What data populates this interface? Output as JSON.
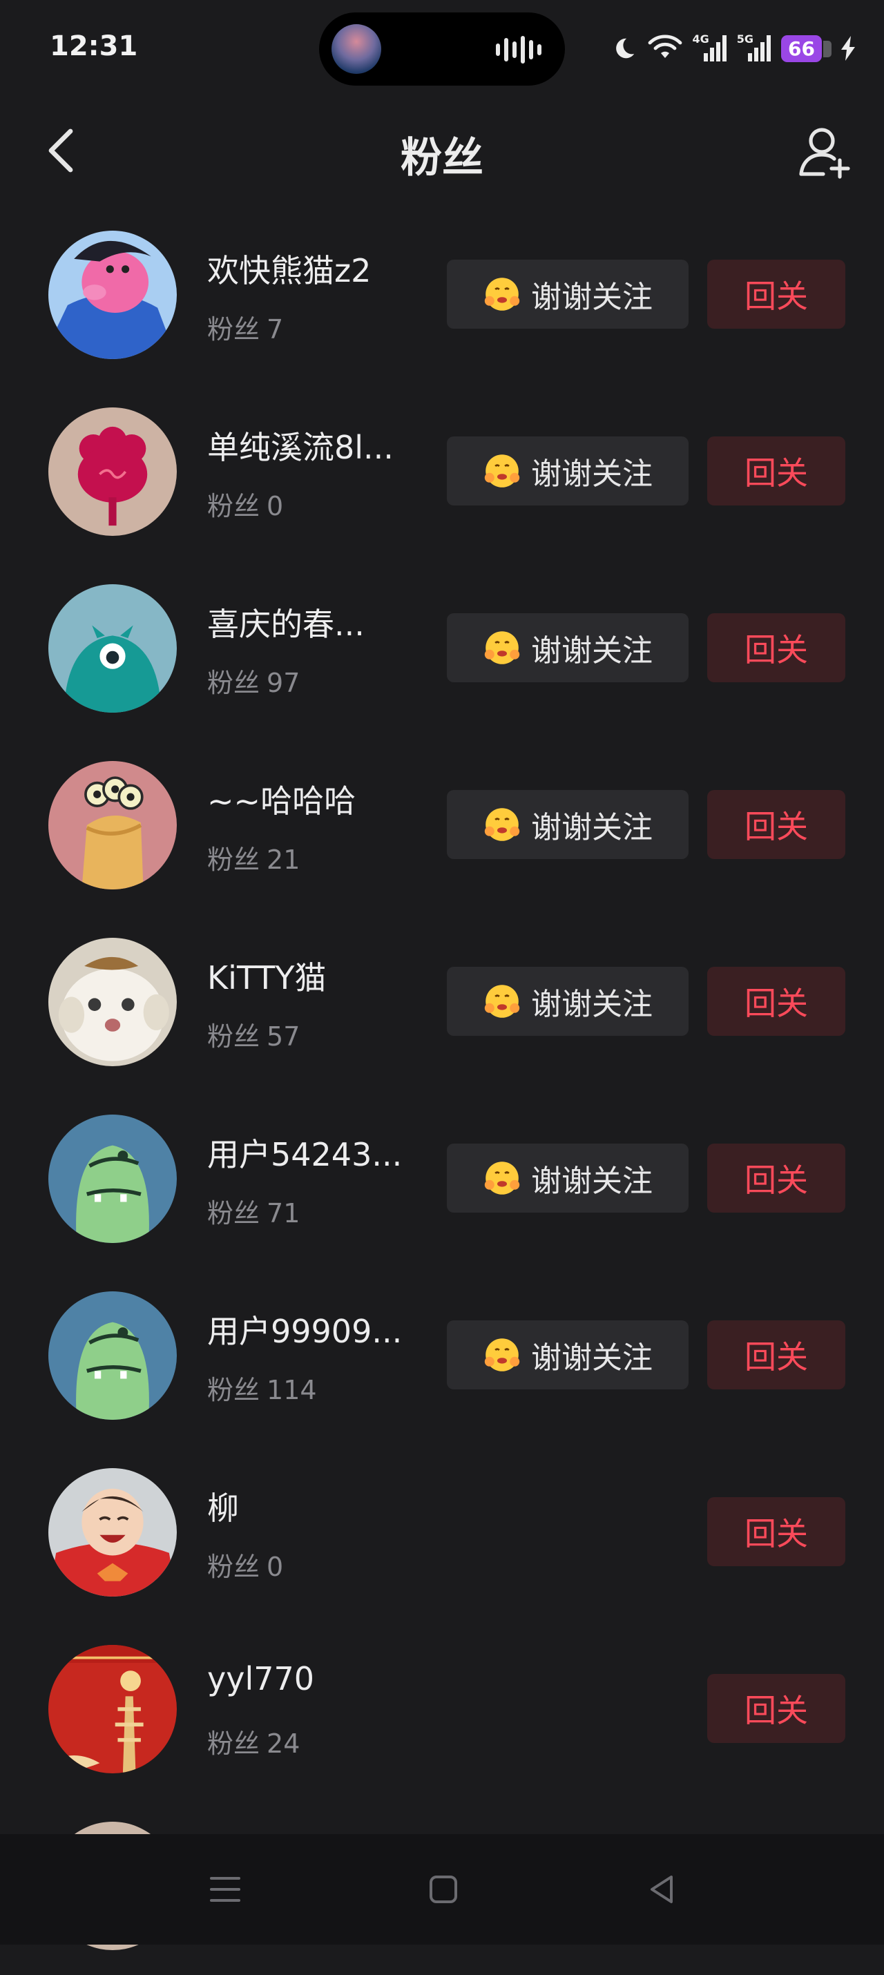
{
  "status_bar": {
    "time": "12:31",
    "net1": "4G",
    "net2": "5G",
    "battery": "66"
  },
  "header": {
    "title": "粉丝"
  },
  "labels": {
    "fans_prefix": "粉丝",
    "thanks": "谢谢关注",
    "follow_back": "回关"
  },
  "fans": [
    {
      "name": "欢快熊猫z2",
      "fans_count": "7",
      "thanks_button": true
    },
    {
      "name": "单纯溪流8l...",
      "fans_count": "0",
      "thanks_button": true
    },
    {
      "name": "喜庆的春...",
      "fans_count": "97",
      "thanks_button": true
    },
    {
      "name": "~~哈哈哈",
      "fans_count": "21",
      "thanks_button": true
    },
    {
      "name": "KiTTY猫",
      "fans_count": "57",
      "thanks_button": true
    },
    {
      "name": "用户54243...",
      "fans_count": "71",
      "thanks_button": true
    },
    {
      "name": "用户99909...",
      "fans_count": "114",
      "thanks_button": true
    },
    {
      "name": "柳",
      "fans_count": "0",
      "thanks_button": false
    },
    {
      "name": "yyl770",
      "fans_count": "24",
      "thanks_button": false
    }
  ],
  "colors": {
    "accent_red": "#fa4a5a",
    "follow_bg": "#3a1f22",
    "thanks_bg": "#2b2b2e",
    "battery": "#9a47e6"
  }
}
